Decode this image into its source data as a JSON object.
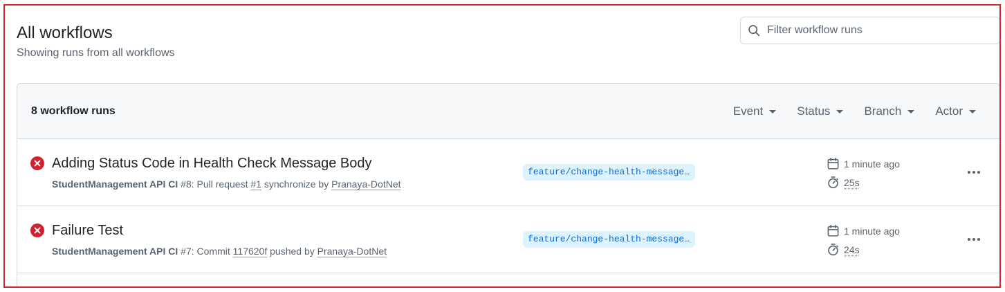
{
  "page": {
    "title": "All workflows",
    "subtitle": "Showing runs from all workflows"
  },
  "search": {
    "placeholder": "Filter workflow runs",
    "value": ""
  },
  "list": {
    "count_label": "8 workflow runs",
    "filters": [
      "Event",
      "Status",
      "Branch",
      "Actor"
    ]
  },
  "runs": [
    {
      "status": "failure",
      "title": "Adding Status Code in Health Check Message Body",
      "workflow": "StudentManagement API CI",
      "run_number": "#8",
      "sep": ":",
      "event_prefix": "Pull request",
      "ref": "#1",
      "event_suffix": "synchronize by",
      "actor": "Pranaya-DotNet",
      "branch": "feature/change-health-message-body",
      "time": "1 minute ago",
      "duration": "25s"
    },
    {
      "status": "failure",
      "title": "Failure Test",
      "workflow": "StudentManagement API CI",
      "run_number": "#7",
      "sep": ":",
      "event_prefix": "Commit",
      "ref": "117620f",
      "event_suffix": "pushed by",
      "actor": "Pranaya-DotNet",
      "branch": "feature/change-health-message-body",
      "time": "1 minute ago",
      "duration": "24s"
    }
  ],
  "colors": {
    "frame_border": "#d9262e",
    "failure": "#cf222e",
    "branch_bg": "#ddf4ff",
    "branch_text": "#0969da",
    "muted": "#59636e"
  },
  "icons": {
    "search": "search-icon",
    "status": "x-circle-fill-icon",
    "calendar": "calendar-icon",
    "stopwatch": "stopwatch-icon",
    "more": "kebab-horizontal-icon"
  }
}
